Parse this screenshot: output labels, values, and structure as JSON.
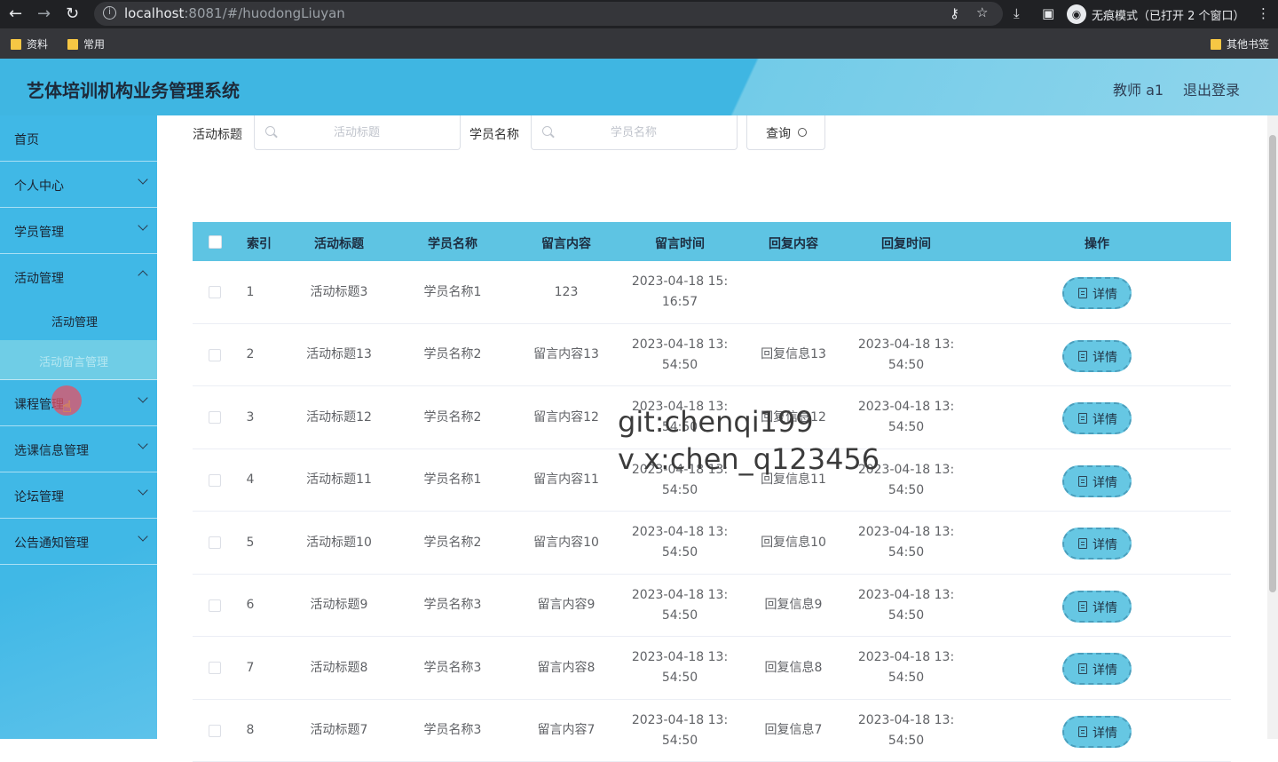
{
  "browser": {
    "url_host": "localhost",
    "url_rest": ":8081/#/huodongLiuyan",
    "incognito_label": "无痕模式（已打开 2 个窗口）",
    "bookmarks": [
      "资料",
      "常用"
    ],
    "other_bookmarks": "其他书签"
  },
  "header": {
    "title": "艺体培训机构业务管理系统",
    "user": "教师 a1",
    "logout": "退出登录"
  },
  "sidebar": {
    "home": "首页",
    "personal": "个人中心",
    "students": "学员管理",
    "activity": "活动管理",
    "activity_sub": "活动管理",
    "activity_msg": "活动留言管理",
    "course": "课程管理",
    "enroll": "选课信息管理",
    "forum": "论坛管理",
    "notice": "公告通知管理"
  },
  "search": {
    "title_label": "活动标题",
    "title_placeholder": "活动标题",
    "student_label": "学员名称",
    "student_placeholder": "学员名称",
    "query_label": "查询"
  },
  "table": {
    "headers": [
      "索引",
      "活动标题",
      "学员名称",
      "留言内容",
      "留言时间",
      "回复内容",
      "回复时间",
      "操作"
    ],
    "detail_label": "详情",
    "rows": [
      {
        "index": "1",
        "title": "活动标题3",
        "student": "学员名称1",
        "content": "123",
        "time1": "2023-04-18 15:",
        "time2": "16:57",
        "reply": "",
        "rtime1": "",
        "rtime2": ""
      },
      {
        "index": "2",
        "title": "活动标题13",
        "student": "学员名称2",
        "content": "留言内容13",
        "time1": "2023-04-18 13:",
        "time2": "54:50",
        "reply": "回复信息13",
        "rtime1": "2023-04-18 13:",
        "rtime2": "54:50"
      },
      {
        "index": "3",
        "title": "活动标题12",
        "student": "学员名称2",
        "content": "留言内容12",
        "time1": "2023-04-18 13:",
        "time2": "54:50",
        "reply": "回复信息12",
        "rtime1": "2023-04-18 13:",
        "rtime2": "54:50"
      },
      {
        "index": "4",
        "title": "活动标题11",
        "student": "学员名称1",
        "content": "留言内容11",
        "time1": "2023-04-18 13:",
        "time2": "54:50",
        "reply": "回复信息11",
        "rtime1": "2023-04-18 13:",
        "rtime2": "54:50"
      },
      {
        "index": "5",
        "title": "活动标题10",
        "student": "学员名称2",
        "content": "留言内容10",
        "time1": "2023-04-18 13:",
        "time2": "54:50",
        "reply": "回复信息10",
        "rtime1": "2023-04-18 13:",
        "rtime2": "54:50"
      },
      {
        "index": "6",
        "title": "活动标题9",
        "student": "学员名称3",
        "content": "留言内容9",
        "time1": "2023-04-18 13:",
        "time2": "54:50",
        "reply": "回复信息9",
        "rtime1": "2023-04-18 13:",
        "rtime2": "54:50"
      },
      {
        "index": "7",
        "title": "活动标题8",
        "student": "学员名称3",
        "content": "留言内容8",
        "time1": "2023-04-18 13:",
        "time2": "54:50",
        "reply": "回复信息8",
        "rtime1": "2023-04-18 13:",
        "rtime2": "54:50"
      },
      {
        "index": "8",
        "title": "活动标题7",
        "student": "学员名称3",
        "content": "留言内容7",
        "time1": "2023-04-18 13:",
        "time2": "54:50",
        "reply": "回复信息7",
        "rtime1": "2023-04-18 13:",
        "rtime2": "54:50"
      }
    ]
  },
  "watermark": {
    "line1": "git:chenqi199",
    "line2": "v x:chen_q123456"
  },
  "colors": {
    "header": "#3fb6e2",
    "sidebar": "#40b8e6",
    "table_header": "#5ec4e3",
    "detail_button": "#66c7e3"
  }
}
